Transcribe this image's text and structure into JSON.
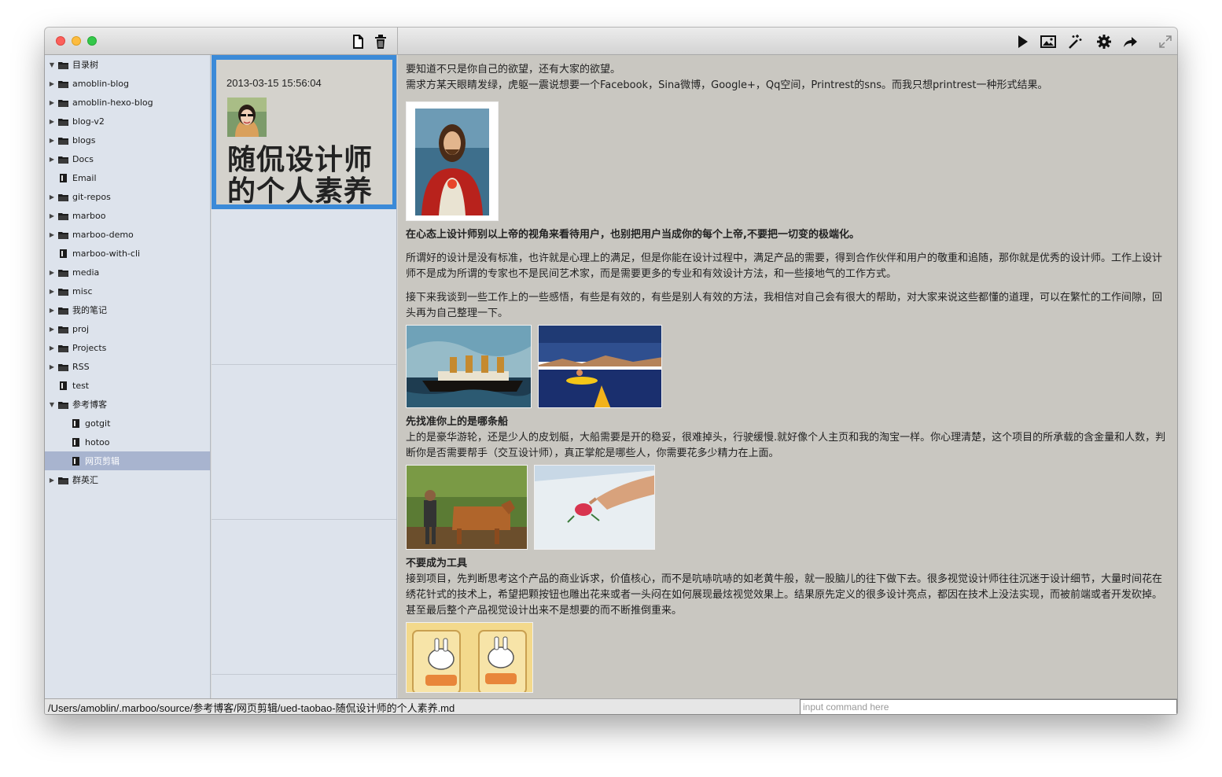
{
  "toolbar": {
    "left_buttons": [
      {
        "icon": "new-document-icon"
      },
      {
        "icon": "trash-icon"
      }
    ],
    "right_buttons": [
      {
        "icon": "play-icon"
      },
      {
        "icon": "image-icon"
      },
      {
        "icon": "magic-wand-icon"
      },
      {
        "icon": "gear-icon"
      },
      {
        "icon": "share-arrow-icon"
      },
      {
        "icon": "fullscreen-icon"
      }
    ]
  },
  "tree": [
    {
      "label": "目录树",
      "type": "folder",
      "expanded": true,
      "level": 0
    },
    {
      "label": "amoblin-blog",
      "type": "folder",
      "expanded": false,
      "level": 0
    },
    {
      "label": "amoblin-hexo-blog",
      "type": "folder",
      "expanded": false,
      "level": 0
    },
    {
      "label": "blog-v2",
      "type": "folder",
      "expanded": false,
      "level": 0
    },
    {
      "label": "blogs",
      "type": "folder",
      "expanded": false,
      "level": 0
    },
    {
      "label": "Docs",
      "type": "folder",
      "expanded": false,
      "level": 0
    },
    {
      "label": "Email",
      "type": "file",
      "level": 0
    },
    {
      "label": "git-repos",
      "type": "folder",
      "expanded": false,
      "level": 0
    },
    {
      "label": "marboo",
      "type": "folder",
      "expanded": false,
      "level": 0
    },
    {
      "label": "marboo-demo",
      "type": "folder",
      "expanded": false,
      "level": 0
    },
    {
      "label": "marboo-with-cli",
      "type": "file",
      "level": 0
    },
    {
      "label": "media",
      "type": "folder",
      "expanded": false,
      "level": 0
    },
    {
      "label": "misc",
      "type": "folder",
      "expanded": false,
      "level": 0
    },
    {
      "label": "我的笔记",
      "type": "folder",
      "expanded": false,
      "level": 0
    },
    {
      "label": "proj",
      "type": "folder",
      "expanded": false,
      "level": 0
    },
    {
      "label": "Projects",
      "type": "folder",
      "expanded": false,
      "level": 0
    },
    {
      "label": "RSS",
      "type": "folder",
      "expanded": false,
      "level": 0
    },
    {
      "label": "test",
      "type": "file",
      "level": 0
    },
    {
      "label": "参考博客",
      "type": "folder",
      "expanded": true,
      "level": 0
    },
    {
      "label": "gotgit",
      "type": "file",
      "level": 1
    },
    {
      "label": "hotoo",
      "type": "file",
      "level": 1
    },
    {
      "label": "网页剪辑",
      "type": "file",
      "level": 1,
      "selected": true
    },
    {
      "label": "群英汇",
      "type": "folder",
      "expanded": false,
      "level": 0
    }
  ],
  "card": {
    "date": "2013-03-15 15:56:04",
    "title": "随侃设计师的个人素养"
  },
  "article": {
    "intro_1": "要知道不只是你自己的欲望，还有大家的欲望。",
    "intro_2": "需求方某天眼睛发绿，虎躯一震说想要一个Facebook，Sina微博，Google+，Qq空间，Printrest的sns。而我只想printrest一种形式结果。",
    "heading_1": "在心态上设计师别以上帝的视角来看待用户，也别把用户当成你的每个上帝,不要把一切变的极端化。",
    "para_1": "所谓好的设计是没有标准，也许就是心理上的满足，但是你能在设计过程中，满足产品的需要，得到合作伙伴和用户的敬重和追随，那你就是优秀的设计师。工作上设计师不是成为所谓的专家也不是民间艺术家，而是需要更多的专业和有效设计方法，和一些接地气的工作方式。",
    "para_2": "接下来我谈到一些工作上的一些感悟，有些是有效的，有些是别人有效的方法，我相信对自己会有很大的帮助，对大家来说这些都懂的道理，可以在繁忙的工作间隙，回头再为自己整理一下。",
    "heading_2": "先找准你上的是哪条船",
    "para_3": "上的是豪华游轮，还是少人的皮划艇，大船需要是开的稳妥，很难掉头，行驶缓慢.就好像个人主页和我的淘宝一样。你心理清楚，这个项目的所承载的含金量和人数，判断你是否需要帮手（交互设计师），真正掌舵是哪些人，你需要花多少精力在上面。",
    "heading_3": "不要成为工具",
    "para_4": "接到项目，先判断思考这个产品的商业诉求，价值核心，而不是吭哧吭哧的如老黄牛般，就一股脑儿的往下做下去。很多视觉设计师往往沉迷于设计细节，大量时间花在绣花针式的技术上，希望把颗按钮也雕出花来或者一头闷在如何展现最炫视觉效果上。结果原先定义的很多设计亮点，都因在技术上没法实现，而被前端或者开发砍掉。甚至最后整个产品视觉设计出来不是想要的而不断推倒重来。",
    "images": [
      "jesus-portrait",
      "titanic-ship",
      "kayak",
      "farmer-with-ox",
      "hand-painting",
      "cartoon-rabbits"
    ]
  },
  "status": {
    "path": "/Users/amoblin/.marboo/source/参考博客/网页剪辑/ued-taobao-随侃设计师的个人素养.md",
    "command_placeholder": "input command here"
  }
}
